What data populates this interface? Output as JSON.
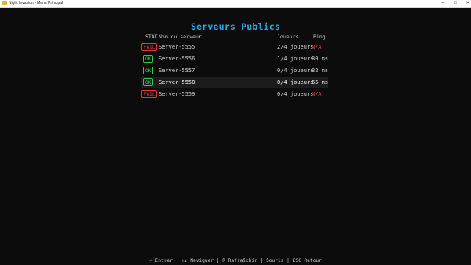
{
  "window": {
    "title": "Night Invasion - Menu Principal",
    "minimize": "–",
    "maximize": "□",
    "close": "✕"
  },
  "heading": "Serveurs Publics",
  "table": {
    "headers": {
      "status": "STAT",
      "name": "Nom du serveur",
      "players": "Joueurs",
      "ping": "Ping"
    },
    "rows": [
      {
        "status": "FAIL",
        "name": "Server-5555",
        "players": "2/4 joueurs",
        "ping": "N/A",
        "selected": false
      },
      {
        "status": "OK",
        "name": "Server-5556",
        "players": "1/4 joueurs",
        "ping": "80 ms",
        "selected": false
      },
      {
        "status": "OK",
        "name": "Server-5557",
        "players": "0/4 joueurs",
        "ping": "82 ms",
        "selected": false
      },
      {
        "status": "OK",
        "name": "Server-5558",
        "players": "0/4 joueurs",
        "ping": "65 ms",
        "selected": true
      },
      {
        "status": "FAIL",
        "name": "Server-5559",
        "players": "0/4 joueurs",
        "ping": "N/A",
        "selected": false
      }
    ]
  },
  "footer": "⏎ Entrer | ↑↓ Naviguer | R Rafraîchir | Souris | ESC Retour",
  "colors": {
    "accent": "#2ea8e0",
    "ok": "#33c94a",
    "fail": "#e33b3b",
    "background": "#0c0c0c"
  }
}
